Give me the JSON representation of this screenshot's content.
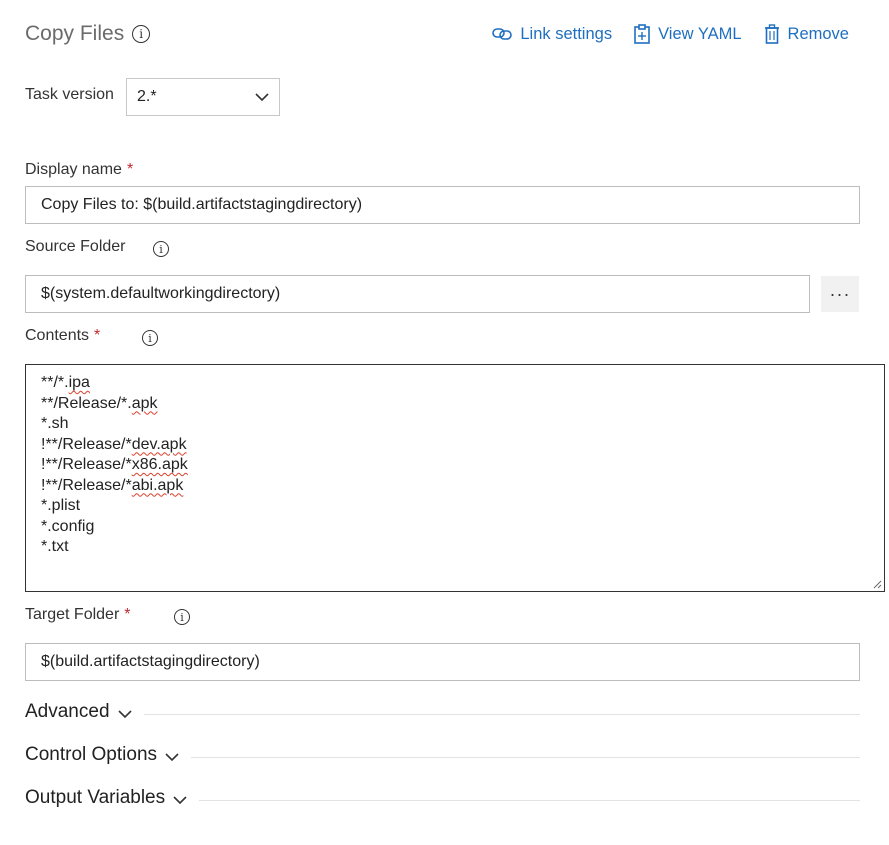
{
  "header": {
    "title": "Copy Files",
    "actions": {
      "link_settings": "Link settings",
      "view_yaml": "View YAML",
      "remove": "Remove"
    }
  },
  "task_version": {
    "label": "Task version",
    "value": "2.*"
  },
  "display_name": {
    "label": "Display name",
    "required_mark": "*",
    "value": "Copy Files to: $(build.artifactstagingdirectory)"
  },
  "source_folder": {
    "label": "Source Folder",
    "value": "$(system.defaultworkingdirectory)",
    "browse_label": "···"
  },
  "contents": {
    "label": "Contents",
    "required_mark": "*",
    "lines": [
      [
        "**/*.",
        "ipa"
      ],
      [
        "**/Release/*.",
        "apk"
      ],
      [
        "*.sh",
        ""
      ],
      [
        "!**/Release/*",
        "dev.apk"
      ],
      [
        "!**/Release/*",
        "x86.apk"
      ],
      [
        "!**/Release/*",
        "abi.apk"
      ],
      [
        "*.plist",
        ""
      ],
      [
        "*.config",
        ""
      ],
      [
        "*.txt",
        ""
      ]
    ]
  },
  "target_folder": {
    "label": "Target Folder",
    "required_mark": "*",
    "value": "$(build.artifactstagingdirectory)"
  },
  "sections": {
    "advanced": "Advanced",
    "control_options": "Control Options",
    "output_variables": "Output Variables"
  },
  "colors": {
    "link": "#1f6fc0",
    "required": "#c4262e",
    "title": "#6b6b6b"
  }
}
